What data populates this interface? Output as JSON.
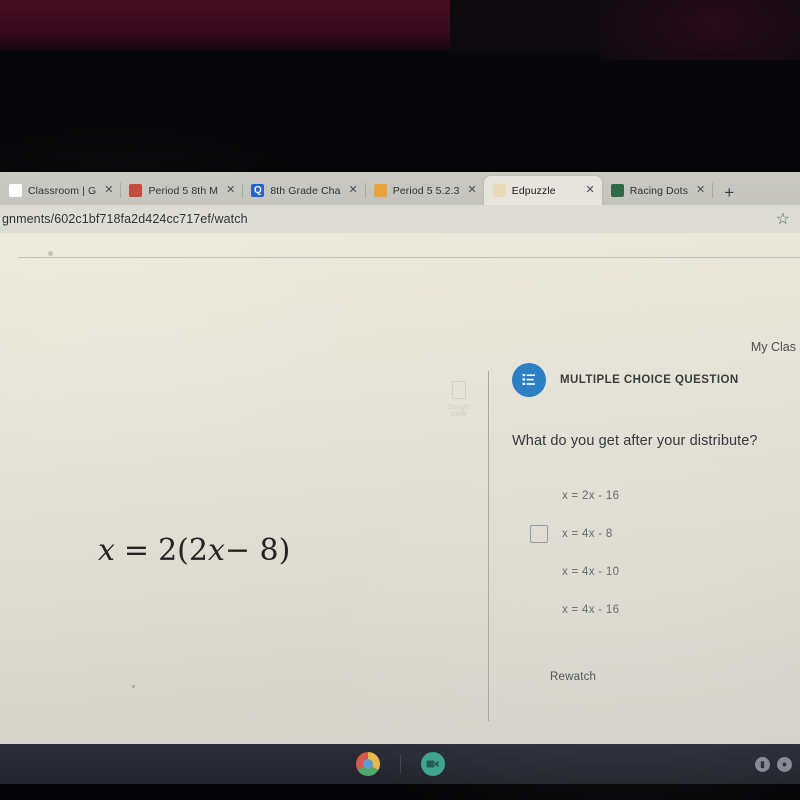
{
  "browser": {
    "tabs": [
      {
        "title": "Classroom | G",
        "favicon": "google-icon",
        "glyph": "G",
        "active": false
      },
      {
        "title": "Period 5 8th M",
        "favicon": "classroom-icon",
        "glyph": "■",
        "active": false
      },
      {
        "title": "8th Grade Cha",
        "favicon": "quizizz-icon",
        "glyph": "Q",
        "active": false
      },
      {
        "title": "Period 5 5.2.3",
        "favicon": "doc-icon",
        "glyph": "",
        "active": false
      },
      {
        "title": "Edpuzzle",
        "favicon": "edpuzzle-icon",
        "glyph": "",
        "active": true
      },
      {
        "title": "Racing Dots",
        "favicon": "racing-dots-icon",
        "glyph": "",
        "active": false
      }
    ],
    "close_label": "✕",
    "new_tab_label": "+",
    "url": "gnments/602c1bf718fa2d424cc717ef/watch",
    "bookmark_icon": "☆"
  },
  "page": {
    "nav_right_label": "My Clas",
    "watermark_label": "Google Slide",
    "equation": {
      "lhs": "x",
      "equals": "=",
      "rhs_prefix": "2(2",
      "rhs_var": "x",
      "rhs_suffix": "− 8)"
    }
  },
  "question": {
    "type_label": "MULTIPLE CHOICE QUESTION",
    "icon": "list-icon",
    "prompt": "What do you get after your distribute?",
    "choices": [
      {
        "text": "x = 2x - 16",
        "checkbox_visible": false
      },
      {
        "text": "x = 4x - 8",
        "checkbox_visible": true
      },
      {
        "text": "x = 4x - 10",
        "checkbox_visible": false
      },
      {
        "text": "x = 4x - 16",
        "checkbox_visible": false
      }
    ],
    "rewatch_label": "Rewatch"
  },
  "shelf": {
    "apps": [
      {
        "name": "chrome-icon"
      },
      {
        "name": "camera-icon"
      }
    ],
    "tray": [
      {
        "name": "battery-icon",
        "glyph": "▮"
      },
      {
        "name": "status-icon",
        "glyph": "●"
      }
    ]
  },
  "colors": {
    "accent_blue": "#2e80c4",
    "page_bg": "#e4e2d9",
    "tabstrip": "#c6c5bf",
    "shelf": "#2b2d38"
  }
}
